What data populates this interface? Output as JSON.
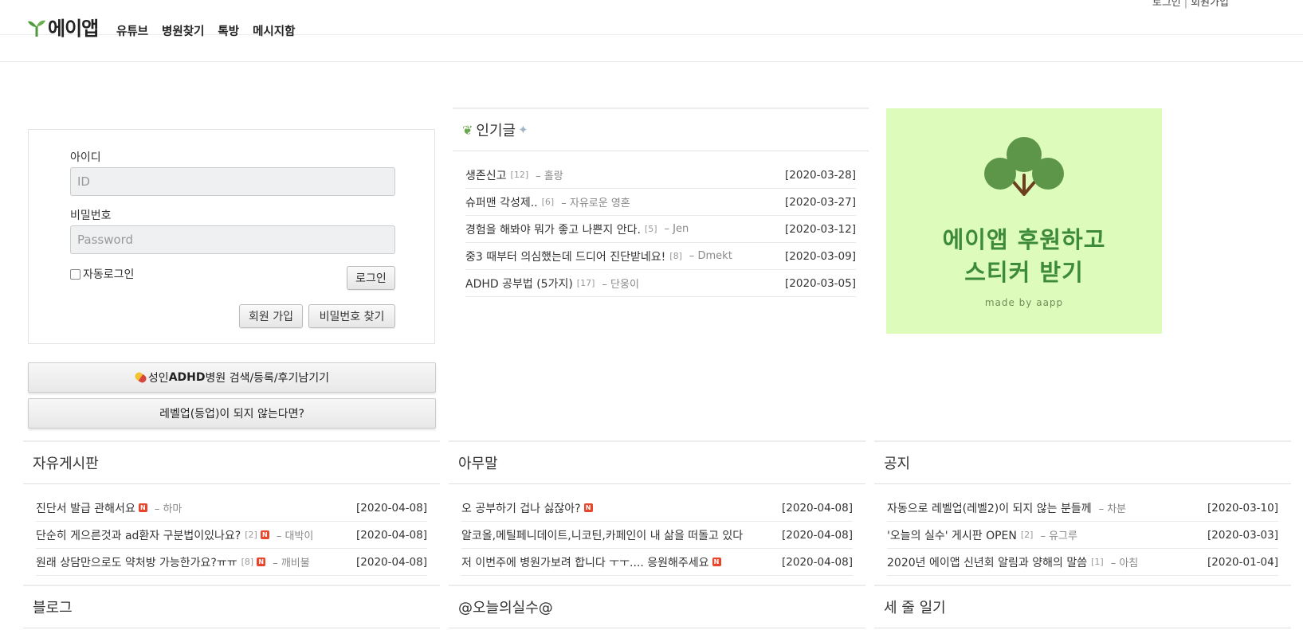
{
  "header": {
    "brand": "에이앱",
    "nav": [
      "유튜브",
      "병원찾기",
      "톡방",
      "메시지함"
    ],
    "login_link": "로그인",
    "signup_link": "회원가입"
  },
  "login": {
    "id_label": "아이디",
    "id_placeholder": "ID",
    "pw_label": "비밀번호",
    "pw_placeholder": "Password",
    "autologin_label": "자동로그인",
    "login_button": "로그인",
    "signup_button": "회원 가입",
    "find_pw_button": "비밀번호 찾기"
  },
  "buttons": {
    "hospital": {
      "prefix": "성인",
      "bold": "ADHD",
      "suffix": "병원 검색/등록/후기남기기"
    },
    "levelup": "레벨업(등업)이 되지 않는다면?"
  },
  "popular": {
    "title": "인기글",
    "rows": [
      {
        "title": "생존신고",
        "count": "[12]",
        "author": "– 홀랑",
        "date": "[2020-03-28]"
      },
      {
        "title": "슈퍼맨 각성제..",
        "count": "[6]",
        "author": "– 자유로운 영혼",
        "date": "[2020-03-27]"
      },
      {
        "title": "경험을 해봐야 뭐가 좋고 나쁜지 안다.",
        "count": "[5]",
        "author": "– Jen",
        "date": "[2020-03-12]"
      },
      {
        "title": "중3 때부터 의심했는데 드디어 진단받네요!",
        "count": "[8]",
        "author": "– Dmekt",
        "date": "[2020-03-09]"
      },
      {
        "title": "ADHD 공부법 (5가지)",
        "count": "[17]",
        "author": "– 단웅이",
        "date": "[2020-03-05]"
      }
    ]
  },
  "banner": {
    "line1": "에이앱 후원하고",
    "line2": "스티커 받기",
    "line3": "made by aapp"
  },
  "boards": [
    {
      "title": "자유게시판",
      "rows": [
        {
          "title": "진단서 발급 관해서요",
          "count": "",
          "new": "N",
          "author": "– 하마",
          "date": "[2020-04-08]"
        },
        {
          "title": "단순히 게으른것과 ad환자 구분법이있나요?",
          "count": "[2]",
          "new": "N",
          "author": "– 대박이",
          "date": "[2020-04-08]"
        },
        {
          "title": "원래 상담만으로도 약처방 가능한가요?ㅠㅠ",
          "count": "[8]",
          "new": "N",
          "author": "– 깨비불",
          "date": "[2020-04-08]"
        }
      ]
    },
    {
      "title": "아무말",
      "rows": [
        {
          "title": "오 공부하기 겁나 싫잖아?",
          "count": "",
          "new": "N",
          "author": "",
          "date": "[2020-04-08]"
        },
        {
          "title": "알코올,메틸페니데이트,니코틴,카페인이 내 삶을 떠돌고 있다",
          "count": "",
          "new": "",
          "author": "",
          "date": "[2020-04-08]"
        },
        {
          "title": "저 이번주에 병원가보려 합니다 ㅜㅜ.... 응원해주세요",
          "count": "",
          "new": "N",
          "author": "",
          "date": "[2020-04-08]"
        }
      ]
    },
    {
      "title": "공지",
      "rows": [
        {
          "title": "자동으로 레벨업(레벨2)이 되지 않는 분들께",
          "count": "",
          "new": "",
          "author": "– 차분",
          "date": "[2020-03-10]"
        },
        {
          "title": "'오늘의 실수' 게시판 OPEN",
          "count": "[2]",
          "new": "",
          "author": "– 유그루",
          "date": "[2020-03-03]"
        },
        {
          "title": "2020년 에이앱 신년회 알림과 양해의 말씀",
          "count": "[1]",
          "new": "",
          "author": "– 아침",
          "date": "[2020-01-04]"
        }
      ]
    }
  ],
  "bottom_boards": [
    "블로그",
    "@오늘의실수@",
    "세 줄 일기"
  ],
  "colors": {
    "brand_green": "#4f9a3f",
    "banner_bg": "#ddfcbc",
    "new_badge": "#e8462c"
  }
}
